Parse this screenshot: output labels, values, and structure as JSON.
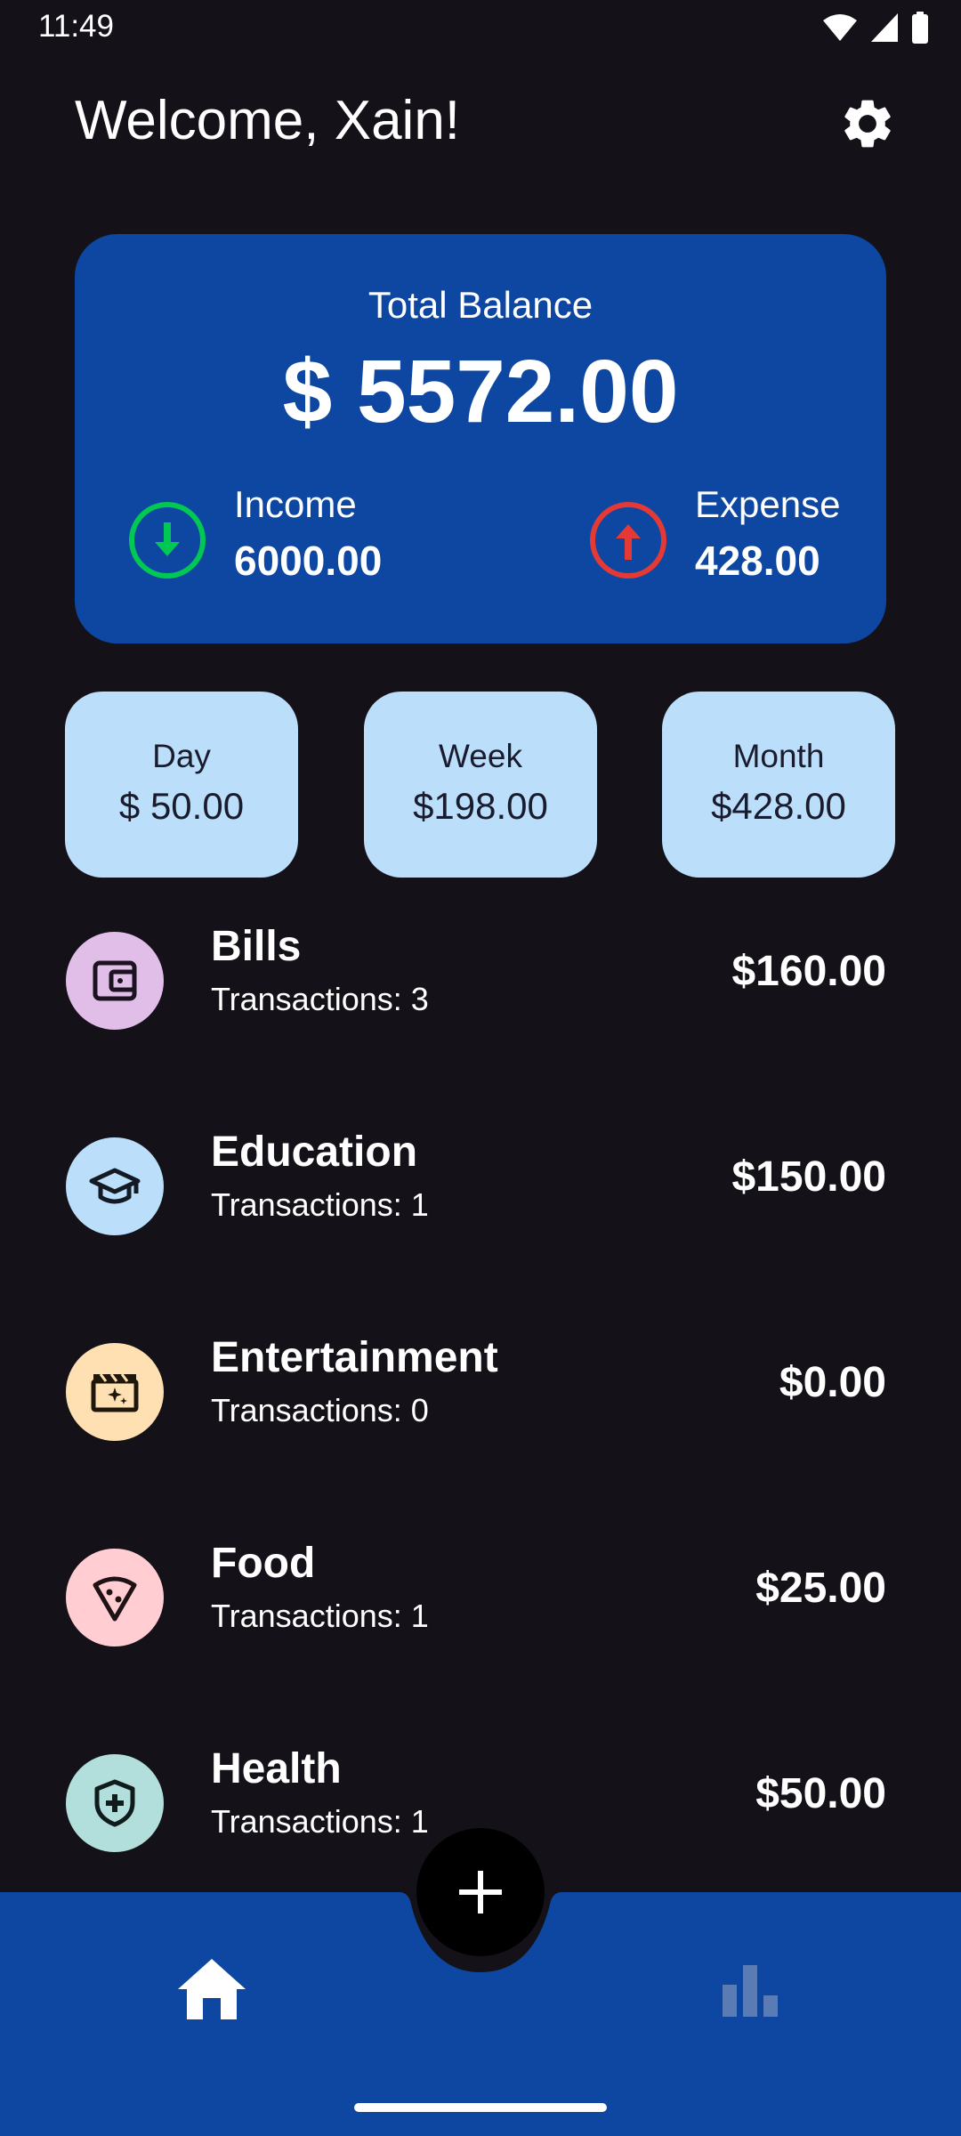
{
  "status_bar": {
    "time": "11:49"
  },
  "header": {
    "welcome": "Welcome, Xain!"
  },
  "balance": {
    "label": "Total Balance",
    "value": "$ 5572.00",
    "income": {
      "label": "Income",
      "value": "6000.00"
    },
    "expense": {
      "label": "Expense",
      "value": "428.00"
    }
  },
  "periods": [
    {
      "label": "Day",
      "value": "$ 50.00"
    },
    {
      "label": "Week",
      "value": "$198.00"
    },
    {
      "label": "Month",
      "value": "$428.00"
    }
  ],
  "categories": [
    {
      "name": "Bills",
      "count": "Transactions: 3",
      "amount": "$160.00",
      "icon": "wallet-icon",
      "color": "#e1bee7"
    },
    {
      "name": "Education",
      "count": "Transactions: 1",
      "amount": "$150.00",
      "icon": "graduation-cap-icon",
      "color": "#bbdefb"
    },
    {
      "name": "Entertainment",
      "count": "Transactions: 0",
      "amount": "$0.00",
      "icon": "movie-icon",
      "color": "#ffe0b2"
    },
    {
      "name": "Food",
      "count": "Transactions: 1",
      "amount": "$25.00",
      "icon": "pizza-icon",
      "color": "#ffcdd2"
    },
    {
      "name": "Health",
      "count": "Transactions: 1",
      "amount": "$50.00",
      "icon": "shield-plus-icon",
      "color": "#b2dfdb"
    }
  ],
  "colors": {
    "background": "#141218",
    "accent": "#0d47a1",
    "income": "#00c853",
    "expense": "#e53935",
    "period_tile": "#bbdefb"
  },
  "nav": {
    "home_icon": "home-icon",
    "stats_icon": "bar-chart-icon",
    "add_icon": "plus-icon"
  }
}
